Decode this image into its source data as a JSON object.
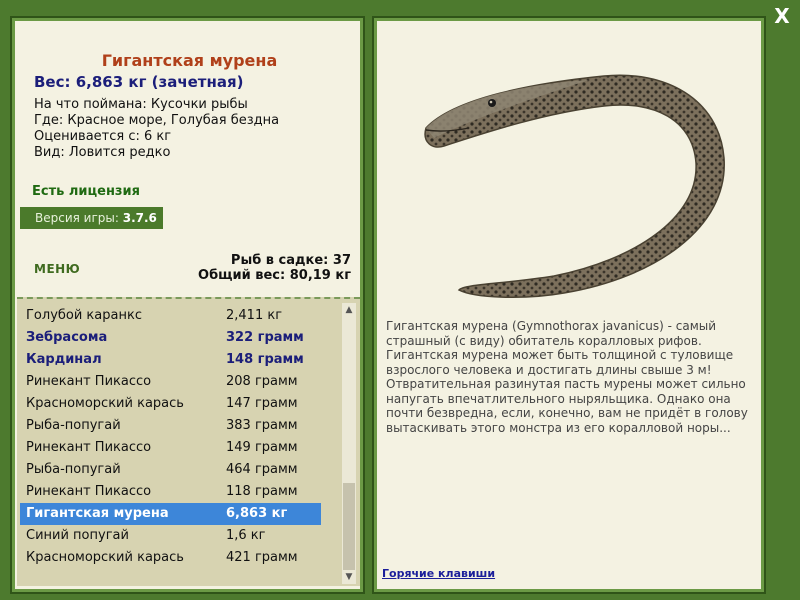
{
  "window": {
    "close_label": "X"
  },
  "fish": {
    "title": "Гигантская мурена",
    "weight": "Вес: 6,863 кг (зачетная)",
    "bait": "На что поймана: Кусочки рыбы",
    "location": "Где: Красное море, Голубая бездна",
    "estimate": "Оценивается с: 6 кг",
    "kind": "Вид: Ловится редко"
  },
  "license": "Есть лицензия",
  "version": {
    "label": "Версия игры:",
    "value": "3.7.6"
  },
  "menu_label": "МЕНЮ",
  "cage": {
    "count": "Рыб в садке: 37",
    "total": "Общий вес: 80,19 кг"
  },
  "catch_list": [
    {
      "name": "Голубой каранкс",
      "weight": "2,411 кг",
      "style": "normal"
    },
    {
      "name": "Зебрасома",
      "weight": "322 грамм",
      "style": "bold"
    },
    {
      "name": "Кардинал",
      "weight": "148 грамм",
      "style": "bold"
    },
    {
      "name": "Ринекант Пикассо",
      "weight": "208 грамм",
      "style": "normal"
    },
    {
      "name": "Красноморский карась",
      "weight": "147 грамм",
      "style": "normal"
    },
    {
      "name": "Рыба-попугай",
      "weight": "383 грамм",
      "style": "normal"
    },
    {
      "name": "Ринекант Пикассо",
      "weight": "149 грамм",
      "style": "normal"
    },
    {
      "name": "Рыба-попугай",
      "weight": "464 грамм",
      "style": "normal"
    },
    {
      "name": "Ринекант Пикассо",
      "weight": "118 грамм",
      "style": "normal"
    },
    {
      "name": "Гигантская мурена",
      "weight": "6,863 кг",
      "style": "selected"
    },
    {
      "name": "Синий попугай",
      "weight": "1,6 кг",
      "style": "normal"
    },
    {
      "name": "Красноморский карась",
      "weight": "421 грамм",
      "style": "normal"
    }
  ],
  "description": "Гигантская мурена (Gymnothorax javanicus) - самый страшный (с виду) обитатель коралловых рифов. Гигантская мурена может быть толщиной с туловище взрослого человека и достигать длины свыше 3 м! Отвратительная разинутая пасть мурены может сильно напугать впечатлительного ныряльщика. Однако она почти безвредна, если, конечно, вам не придёт в голову вытаскивать этого монстра из его коралловой норы...",
  "hotkeys_label": "Горячие клавиши",
  "icons": {
    "close": "close-icon",
    "scroll_up": "arrow-up-icon",
    "scroll_down": "arrow-down-icon"
  },
  "colors": {
    "background": "#4d7a2e",
    "panel": "#f4f2e2",
    "title": "#b0401a",
    "weight_text": "#1b1e7a",
    "selected_row": "#3d86d9",
    "license": "#1f6a12"
  }
}
